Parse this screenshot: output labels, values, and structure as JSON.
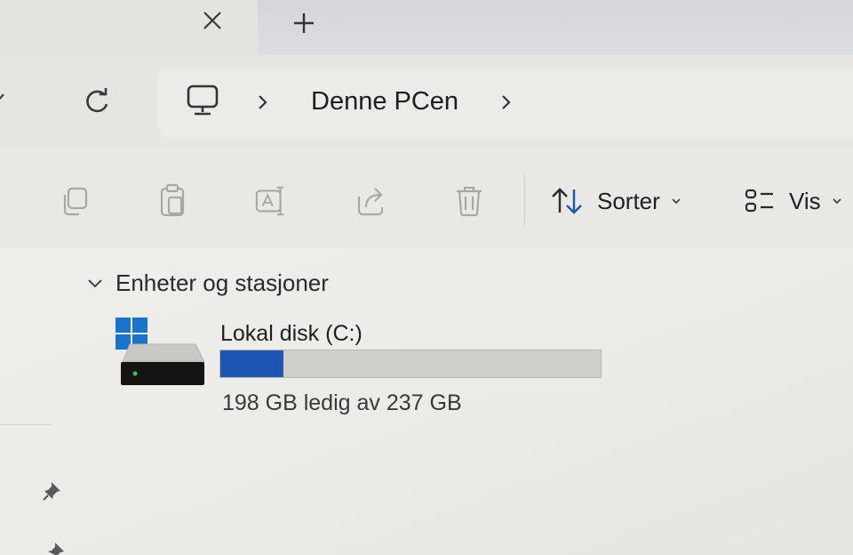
{
  "tabs": {
    "close_icon": "close-icon",
    "new_tab_icon": "plus-icon"
  },
  "navbar": {
    "refresh_icon": "refresh-icon",
    "location_icon": "monitor-icon",
    "breadcrumb": [
      "Denne PCen"
    ]
  },
  "commandbar": {
    "actions": [
      {
        "icon": "copy-icon"
      },
      {
        "icon": "paste-icon"
      },
      {
        "icon": "rename-icon"
      },
      {
        "icon": "share-icon"
      },
      {
        "icon": "delete-icon"
      }
    ],
    "sort_label": "Sorter",
    "view_label": "Vis"
  },
  "content": {
    "group_label": "Enheter og stasjoner",
    "drives": [
      {
        "name": "Lokal disk (C:)",
        "free_text": "198 GB ledig av 237 GB",
        "used_fraction": 0.165
      }
    ]
  },
  "colors": {
    "accent": "#1d55b3",
    "bar_track": "#cfcecb",
    "windows_logo": "#1a73c9"
  }
}
